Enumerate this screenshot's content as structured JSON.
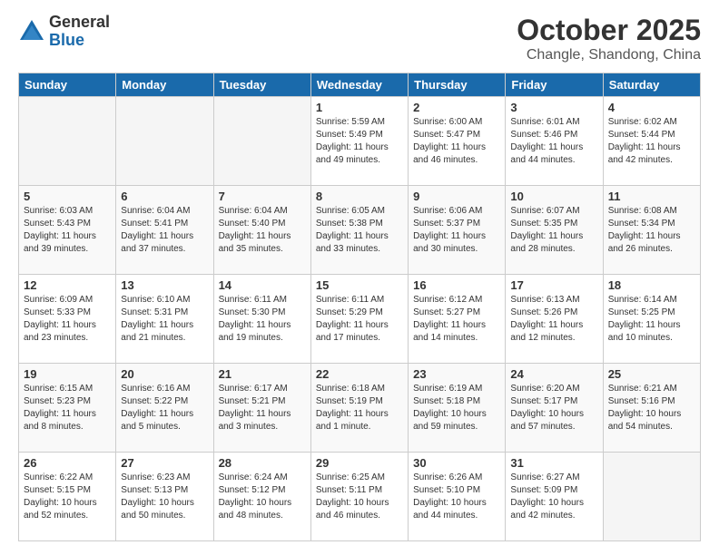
{
  "header": {
    "logo_line1": "General",
    "logo_line2": "Blue",
    "month": "October 2025",
    "location": "Changle, Shandong, China"
  },
  "weekdays": [
    "Sunday",
    "Monday",
    "Tuesday",
    "Wednesday",
    "Thursday",
    "Friday",
    "Saturday"
  ],
  "weeks": [
    [
      {
        "day": "",
        "info": ""
      },
      {
        "day": "",
        "info": ""
      },
      {
        "day": "",
        "info": ""
      },
      {
        "day": "1",
        "info": "Sunrise: 5:59 AM\nSunset: 5:49 PM\nDaylight: 11 hours and 49 minutes."
      },
      {
        "day": "2",
        "info": "Sunrise: 6:00 AM\nSunset: 5:47 PM\nDaylight: 11 hours and 46 minutes."
      },
      {
        "day": "3",
        "info": "Sunrise: 6:01 AM\nSunset: 5:46 PM\nDaylight: 11 hours and 44 minutes."
      },
      {
        "day": "4",
        "info": "Sunrise: 6:02 AM\nSunset: 5:44 PM\nDaylight: 11 hours and 42 minutes."
      }
    ],
    [
      {
        "day": "5",
        "info": "Sunrise: 6:03 AM\nSunset: 5:43 PM\nDaylight: 11 hours and 39 minutes."
      },
      {
        "day": "6",
        "info": "Sunrise: 6:04 AM\nSunset: 5:41 PM\nDaylight: 11 hours and 37 minutes."
      },
      {
        "day": "7",
        "info": "Sunrise: 6:04 AM\nSunset: 5:40 PM\nDaylight: 11 hours and 35 minutes."
      },
      {
        "day": "8",
        "info": "Sunrise: 6:05 AM\nSunset: 5:38 PM\nDaylight: 11 hours and 33 minutes."
      },
      {
        "day": "9",
        "info": "Sunrise: 6:06 AM\nSunset: 5:37 PM\nDaylight: 11 hours and 30 minutes."
      },
      {
        "day": "10",
        "info": "Sunrise: 6:07 AM\nSunset: 5:35 PM\nDaylight: 11 hours and 28 minutes."
      },
      {
        "day": "11",
        "info": "Sunrise: 6:08 AM\nSunset: 5:34 PM\nDaylight: 11 hours and 26 minutes."
      }
    ],
    [
      {
        "day": "12",
        "info": "Sunrise: 6:09 AM\nSunset: 5:33 PM\nDaylight: 11 hours and 23 minutes."
      },
      {
        "day": "13",
        "info": "Sunrise: 6:10 AM\nSunset: 5:31 PM\nDaylight: 11 hours and 21 minutes."
      },
      {
        "day": "14",
        "info": "Sunrise: 6:11 AM\nSunset: 5:30 PM\nDaylight: 11 hours and 19 minutes."
      },
      {
        "day": "15",
        "info": "Sunrise: 6:11 AM\nSunset: 5:29 PM\nDaylight: 11 hours and 17 minutes."
      },
      {
        "day": "16",
        "info": "Sunrise: 6:12 AM\nSunset: 5:27 PM\nDaylight: 11 hours and 14 minutes."
      },
      {
        "day": "17",
        "info": "Sunrise: 6:13 AM\nSunset: 5:26 PM\nDaylight: 11 hours and 12 minutes."
      },
      {
        "day": "18",
        "info": "Sunrise: 6:14 AM\nSunset: 5:25 PM\nDaylight: 11 hours and 10 minutes."
      }
    ],
    [
      {
        "day": "19",
        "info": "Sunrise: 6:15 AM\nSunset: 5:23 PM\nDaylight: 11 hours and 8 minutes."
      },
      {
        "day": "20",
        "info": "Sunrise: 6:16 AM\nSunset: 5:22 PM\nDaylight: 11 hours and 5 minutes."
      },
      {
        "day": "21",
        "info": "Sunrise: 6:17 AM\nSunset: 5:21 PM\nDaylight: 11 hours and 3 minutes."
      },
      {
        "day": "22",
        "info": "Sunrise: 6:18 AM\nSunset: 5:19 PM\nDaylight: 11 hours and 1 minute."
      },
      {
        "day": "23",
        "info": "Sunrise: 6:19 AM\nSunset: 5:18 PM\nDaylight: 10 hours and 59 minutes."
      },
      {
        "day": "24",
        "info": "Sunrise: 6:20 AM\nSunset: 5:17 PM\nDaylight: 10 hours and 57 minutes."
      },
      {
        "day": "25",
        "info": "Sunrise: 6:21 AM\nSunset: 5:16 PM\nDaylight: 10 hours and 54 minutes."
      }
    ],
    [
      {
        "day": "26",
        "info": "Sunrise: 6:22 AM\nSunset: 5:15 PM\nDaylight: 10 hours and 52 minutes."
      },
      {
        "day": "27",
        "info": "Sunrise: 6:23 AM\nSunset: 5:13 PM\nDaylight: 10 hours and 50 minutes."
      },
      {
        "day": "28",
        "info": "Sunrise: 6:24 AM\nSunset: 5:12 PM\nDaylight: 10 hours and 48 minutes."
      },
      {
        "day": "29",
        "info": "Sunrise: 6:25 AM\nSunset: 5:11 PM\nDaylight: 10 hours and 46 minutes."
      },
      {
        "day": "30",
        "info": "Sunrise: 6:26 AM\nSunset: 5:10 PM\nDaylight: 10 hours and 44 minutes."
      },
      {
        "day": "31",
        "info": "Sunrise: 6:27 AM\nSunset: 5:09 PM\nDaylight: 10 hours and 42 minutes."
      },
      {
        "day": "",
        "info": ""
      }
    ]
  ]
}
